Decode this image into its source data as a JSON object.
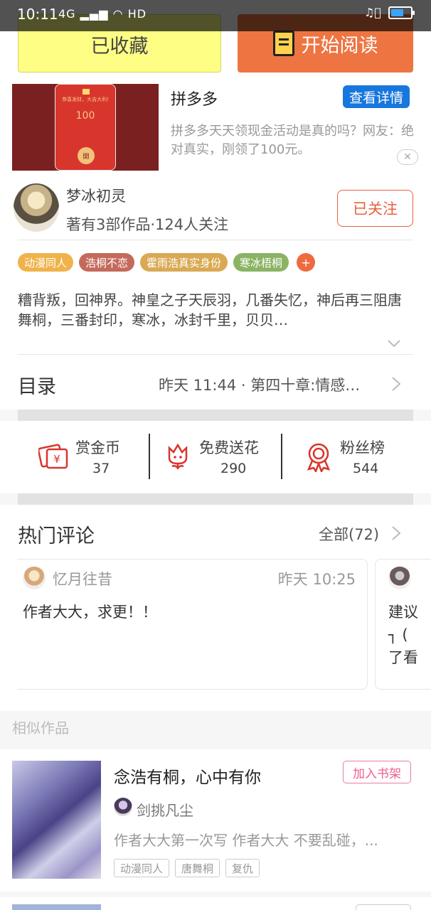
{
  "status_bar": {
    "time": "10:11",
    "network": "4G",
    "hd": "HD"
  },
  "top_actions": {
    "favorited_label": "已收藏",
    "start_reading_label": "开始阅读"
  },
  "ad": {
    "title": "拼多多",
    "detail_button": "查看详情",
    "description": "拼多多天天领现金活动是真的吗？网友：绝对真实，刚领了100元。",
    "image_amount": "100",
    "image_open": "開",
    "image_caption": "恭喜发财，大吉大利!"
  },
  "author": {
    "name": "梦冰初灵",
    "meta": "著有3部作品·124人关注",
    "follow_label": "已关注"
  },
  "tags": [
    {
      "label": "动漫同人",
      "color": "#f0b24a"
    },
    {
      "label": "浩桐不恋",
      "color": "#c46a5c"
    },
    {
      "label": "霍雨浩真实身份",
      "color": "#d9a953"
    },
    {
      "label": "寒冰梧桐",
      "color": "#8ab363"
    }
  ],
  "tag_more": "+",
  "summary": "糟背叛，回神界。神皇之子天辰羽，几番失忆，神后再三阻唐舞桐，三番封印，寒冰，冰封千里，贝贝…",
  "toc": {
    "label": "目录",
    "latest": "昨天 11:44 · 第四十章:情感…"
  },
  "stats": [
    {
      "label": "赏金币",
      "value": "37",
      "icon": "gold-coin-icon"
    },
    {
      "label": "免费送花",
      "value": "290",
      "icon": "flower-icon"
    },
    {
      "label": "粉丝榜",
      "value": "544",
      "icon": "medal-icon"
    }
  ],
  "comments": {
    "title": "热门评论",
    "all_label": "全部(72)",
    "items": [
      {
        "user": "忆月往昔",
        "time": "昨天 10:25",
        "text": "作者大大，求更！！"
      },
      {
        "text": "建议\n┐ (\n了看"
      }
    ]
  },
  "similar": {
    "label": "相似作品",
    "books": [
      {
        "title": "念浩有桐，心中有你",
        "shelf_button": "加入书架",
        "author": "剑挑凡尘",
        "description": "作者大大第一次写 作者大大 不要乱碰，...",
        "tags": [
          "动漫同人",
          "唐舞桐",
          "复仇"
        ]
      }
    ]
  },
  "colors": {
    "favorite_bg": "#fefe84",
    "read_bg": "#ee7542",
    "accent": "#e9603e",
    "detail_blue": "#1777dd",
    "icon_red": "#d9352b"
  }
}
